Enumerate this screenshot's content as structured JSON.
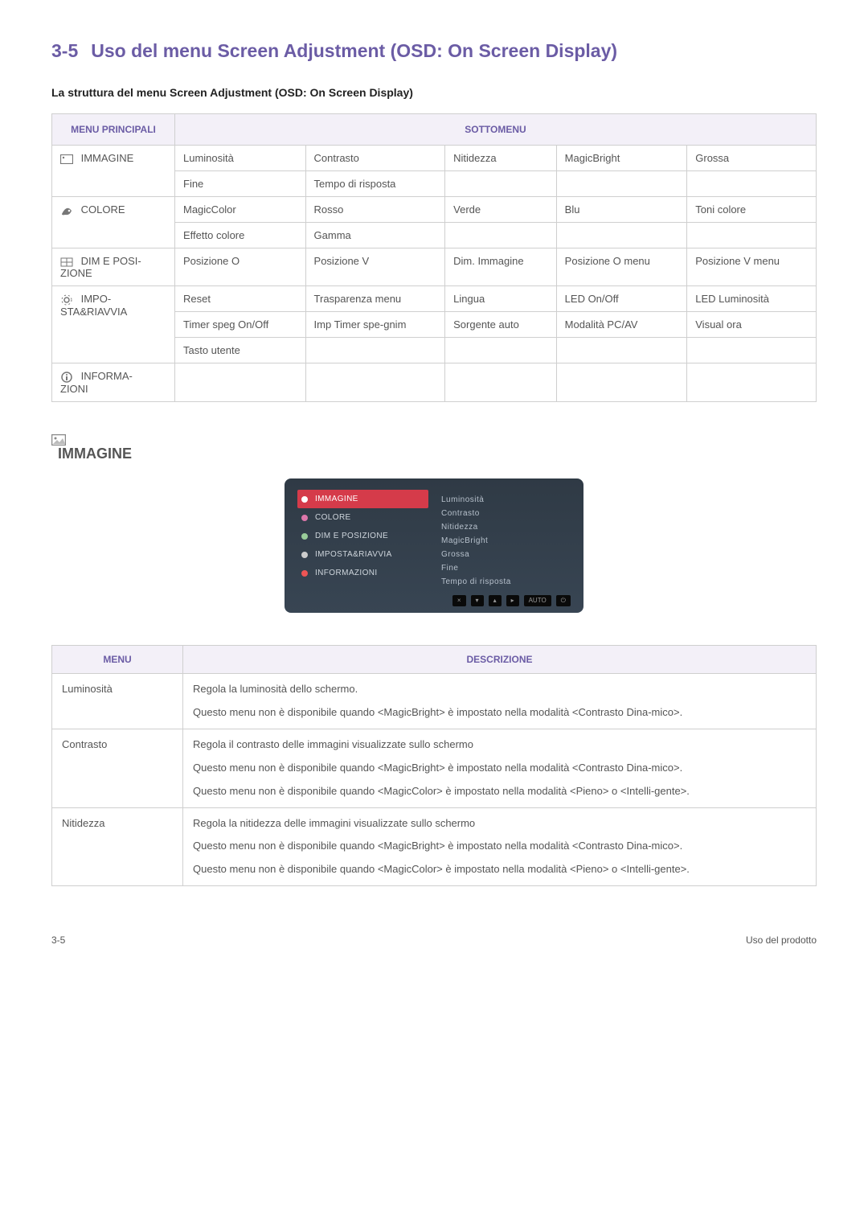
{
  "section_number": "3-5",
  "section_title": "Uso del menu Screen Adjustment (OSD: On Screen Display)",
  "sub_heading": "La struttura del menu Screen Adjustment (OSD: On Screen Display)",
  "table_headers": {
    "main_menus": "MENU PRINCIPALI",
    "submenus": "SOTTOMENU"
  },
  "menu_rows": [
    {
      "icon": "image-icon",
      "label": "IMMAGINE",
      "rows": [
        [
          "Luminosità",
          "Contrasto",
          "Nitidezza",
          "MagicBright",
          "Grossa"
        ],
        [
          "Fine",
          "Tempo di risposta",
          "",
          "",
          ""
        ]
      ]
    },
    {
      "icon": "color-icon",
      "label": "COLORE",
      "rows": [
        [
          "MagicColor",
          "Rosso",
          "Verde",
          "Blu",
          "Toni colore"
        ],
        [
          "Effetto colore",
          "Gamma",
          "",
          "",
          ""
        ]
      ]
    },
    {
      "icon": "position-icon",
      "label": "DIM E POSI-ZIONE",
      "rows": [
        [
          "Posizione O",
          "Posizione V",
          "Dim. Immagine",
          "Posizione O menu",
          "Posizione V menu"
        ]
      ]
    },
    {
      "icon": "settings-icon",
      "label": "IMPO-STA&RIAVVIA",
      "rows": [
        [
          "Reset",
          "Trasparenza menu",
          "Lingua",
          "LED On/Off",
          "LED Luminosità"
        ],
        [
          "Timer speg On/Off",
          "Imp Timer spe-gnim",
          "Sorgente auto",
          "Modalità PC/AV",
          "Visual ora"
        ],
        [
          "Tasto utente",
          "",
          "",
          "",
          ""
        ]
      ]
    },
    {
      "icon": "info-icon",
      "label": "INFORMA-ZIONI",
      "rows": [
        [
          "",
          "",
          "",
          "",
          ""
        ]
      ]
    }
  ],
  "category_heading": "IMMAGINE",
  "osd": {
    "left": [
      {
        "label": "IMMAGINE",
        "selected": true
      },
      {
        "label": "COLORE",
        "selected": false
      },
      {
        "label": "DIM E POSIZIONE",
        "selected": false
      },
      {
        "label": "IMPOSTA&RIAVVIA",
        "selected": false
      },
      {
        "label": "INFORMAZIONI",
        "selected": false
      }
    ],
    "right": [
      "Luminosità",
      "Contrasto",
      "Nitidezza",
      "MagicBright",
      "Grossa",
      "Fine",
      "Tempo di risposta"
    ],
    "footer": [
      "×",
      "▾",
      "▴",
      "▸",
      "AUTO",
      "⏻"
    ]
  },
  "desc_table": {
    "headers": {
      "menu": "MENU",
      "desc": "DESCRIZIONE"
    },
    "rows": [
      {
        "menu": "Luminosità",
        "paras": [
          "Regola la luminosità dello schermo.",
          "Questo menu non è disponibile quando <MagicBright> è impostato nella modalità <Contrasto Dina-mico>."
        ]
      },
      {
        "menu": "Contrasto",
        "paras": [
          "Regola il contrasto delle immagini visualizzate sullo schermo",
          "Questo menu non è disponibile quando <MagicBright> è impostato nella modalità <Contrasto Dina-mico>.",
          "Questo menu non è disponibile quando <MagicColor> è impostato nella modalità <Pieno> o <Intelli-gente>."
        ]
      },
      {
        "menu": "Nitidezza",
        "paras": [
          "Regola la nitidezza delle immagini visualizzate sullo schermo",
          "Questo menu non è disponibile quando <MagicBright> è impostato nella modalità <Contrasto Dina-mico>.",
          "Questo menu non è disponibile quando <MagicColor> è impostato nella modalità <Pieno> o <Intelli-gente>."
        ]
      }
    ]
  },
  "footer_left": "3-5",
  "footer_right": "Uso del prodotto"
}
